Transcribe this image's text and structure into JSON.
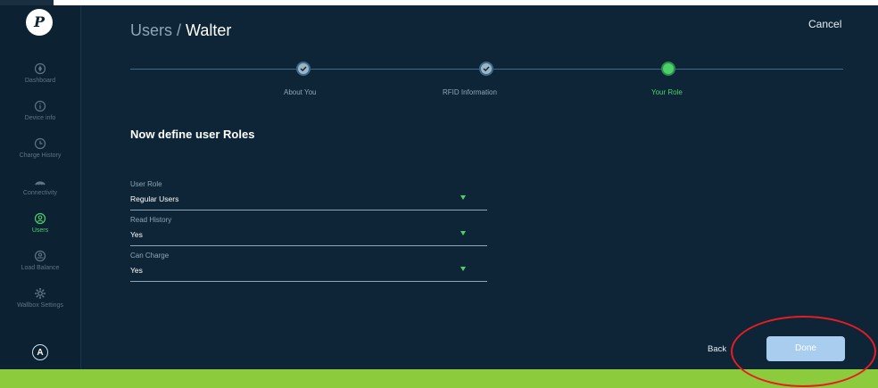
{
  "sidebar": {
    "logo": "P",
    "items": [
      {
        "label": "Dashboard",
        "icon": "dashboard-icon"
      },
      {
        "label": "Device info",
        "icon": "info-icon"
      },
      {
        "label": "Charge History",
        "icon": "clock-icon"
      },
      {
        "label": "Connectivity",
        "icon": "wifi-icon"
      },
      {
        "label": "Users",
        "icon": "user-icon",
        "active": true
      },
      {
        "label": "Load Balance",
        "icon": "balance-icon"
      },
      {
        "label": "Wallbox Settings",
        "icon": "gear-icon"
      }
    ],
    "avatar": "A"
  },
  "header": {
    "breadcrumb_prefix": "Users /",
    "breadcrumb_current": "Walter",
    "cancel_label": "Cancel"
  },
  "stepper": {
    "steps": [
      {
        "label": "About You",
        "state": "done"
      },
      {
        "label": "RFID Information",
        "state": "done"
      },
      {
        "label": "Your Role",
        "state": "active"
      }
    ]
  },
  "form": {
    "heading": "Now define user Roles",
    "fields": [
      {
        "label": "User Role",
        "value": "Regular Users"
      },
      {
        "label": "Read History",
        "value": "Yes"
      },
      {
        "label": "Can Charge",
        "value": "Yes"
      }
    ]
  },
  "footer": {
    "back_label": "Back",
    "done_label": "Done"
  },
  "colors": {
    "background": "#0d2536",
    "accent_green": "#4cd06a",
    "done_button": "#a9cdee",
    "highlight_circle": "#e81c24",
    "bottom_bar": "#8ccc3c"
  }
}
